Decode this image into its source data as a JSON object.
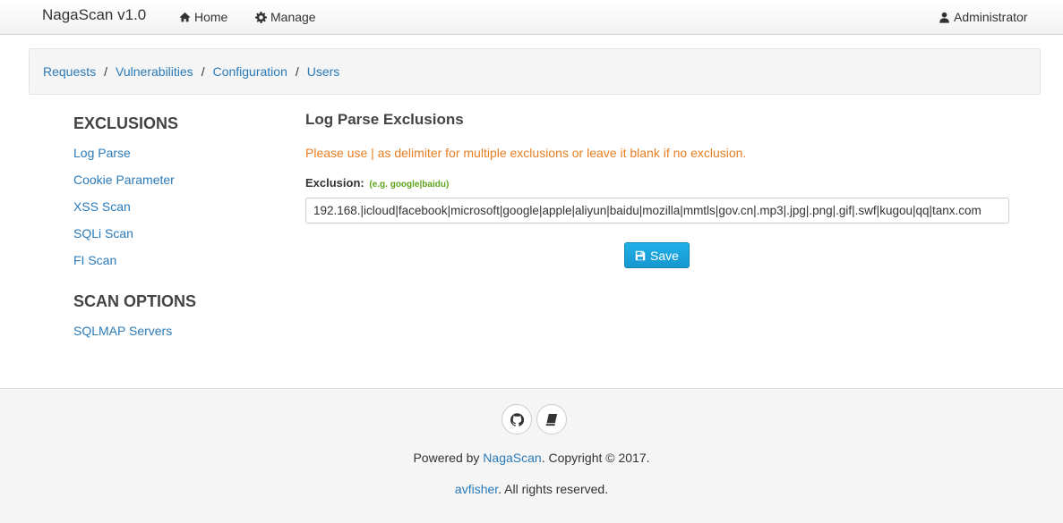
{
  "navbar": {
    "brand": "NagaScan v1.0",
    "home_label": "Home",
    "manage_label": "Manage",
    "user_label": "Administrator"
  },
  "breadcrumb": {
    "items": [
      "Requests",
      "Vulnerabilities",
      "Configuration",
      "Users"
    ],
    "separator": "/"
  },
  "sidebar": {
    "exclusions_heading": "EXCLUSIONS",
    "exclusion_items": [
      "Log Parse",
      "Cookie Parameter",
      "XSS Scan",
      "SQLi Scan",
      "FI Scan"
    ],
    "scan_options_heading": "SCAN OPTIONS",
    "scan_option_items": [
      "SQLMAP Servers"
    ]
  },
  "main": {
    "title": "Log Parse Exclusions",
    "notice": "Please use | as delimiter for multiple exclusions or leave it blank if no exclusion.",
    "field_label": "Exclusion:",
    "field_hint": "(e.g. google|baidu)",
    "field_value": "192.168.|icloud|facebook|microsoft|google|apple|aliyun|baidu|mozilla|mmtls|gov.cn|.mp3|.jpg|.png|.gif|.swf|kugou|qq|tanx.com",
    "save_label": "Save"
  },
  "footer": {
    "powered_prefix": "Powered by ",
    "powered_link": "NagaScan",
    "copyright": ". Copyright © 2017.",
    "author_link": "avfisher",
    "rights": ". All rights reserved."
  },
  "colors": {
    "link": "#2a7ab8",
    "notice": "#e67e22",
    "hint": "#5fa31c",
    "button": "#1697cf"
  }
}
